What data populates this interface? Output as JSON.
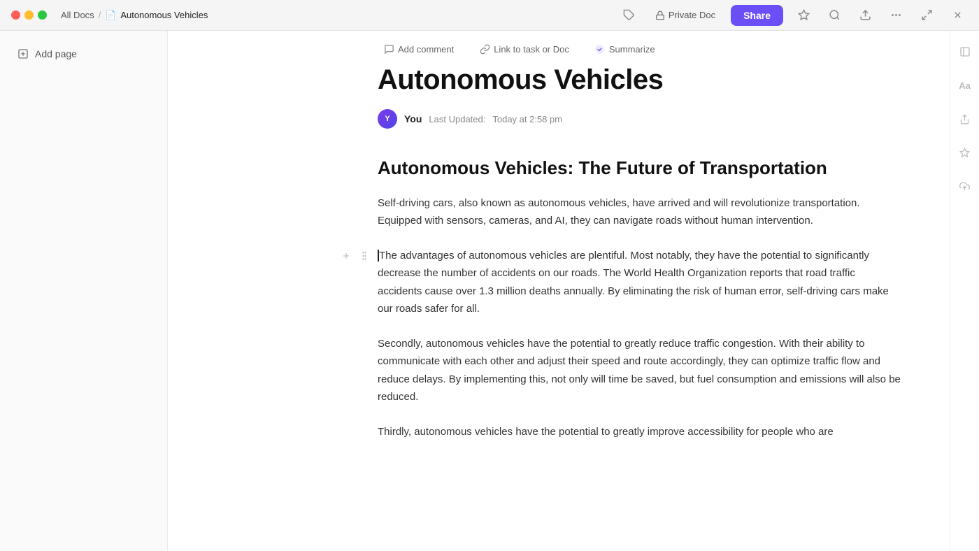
{
  "titlebar": {
    "breadcrumb_all_docs": "All Docs",
    "breadcrumb_separator": "/",
    "doc_title": "Autonomous Vehicles",
    "private_doc_label": "Private Doc",
    "share_label": "Share"
  },
  "icons": {
    "tag": "🏷",
    "lock": "🔒",
    "star": "☆",
    "search": "⌕",
    "export": "↗",
    "more": "···",
    "expand": "⤢",
    "close": "✕",
    "add_page": "⊕",
    "comment": "💬",
    "link": "⟳",
    "summarize_color": "#6b4ef6",
    "indent_left": "⇤",
    "font": "Aa",
    "share_icon": "↗",
    "sparkle": "✦",
    "upload": "↑"
  },
  "left_sidebar": {
    "add_page_label": "Add page"
  },
  "toolbar": {
    "add_comment_label": "Add comment",
    "link_to_task_label": "Link to task or Doc",
    "summarize_label": "Summarize"
  },
  "document": {
    "title": "Autonomous Vehicles",
    "author": "You",
    "last_updated_label": "Last Updated:",
    "last_updated_value": "Today at 2:58 pm",
    "section_heading": "Autonomous Vehicles: The Future of Transportation",
    "paragraph1": "Self-driving cars, also known as autonomous vehicles, have arrived and will revolutionize transportation. Equipped with sensors, cameras, and AI, they can navigate roads without human intervention.",
    "paragraph2": "The advantages of autonomous vehicles are plentiful. Most notably, they have the potential to significantly decrease the number of accidents on our roads. The World Health Organization reports that road traffic accidents cause over 1.3 million deaths annually. By eliminating the risk of human error, self-driving cars make our roads safer for all.",
    "paragraph3": "Secondly, autonomous vehicles have the potential to greatly reduce traffic congestion. With their ability to communicate with each other and adjust their speed and route accordingly, they can optimize traffic flow and reduce delays. By implementing this, not only will time be saved, but fuel consumption and emissions will also be reduced.",
    "paragraph4": "Thirdly, autonomous vehicles have the potential to greatly improve accessibility for people who are"
  }
}
